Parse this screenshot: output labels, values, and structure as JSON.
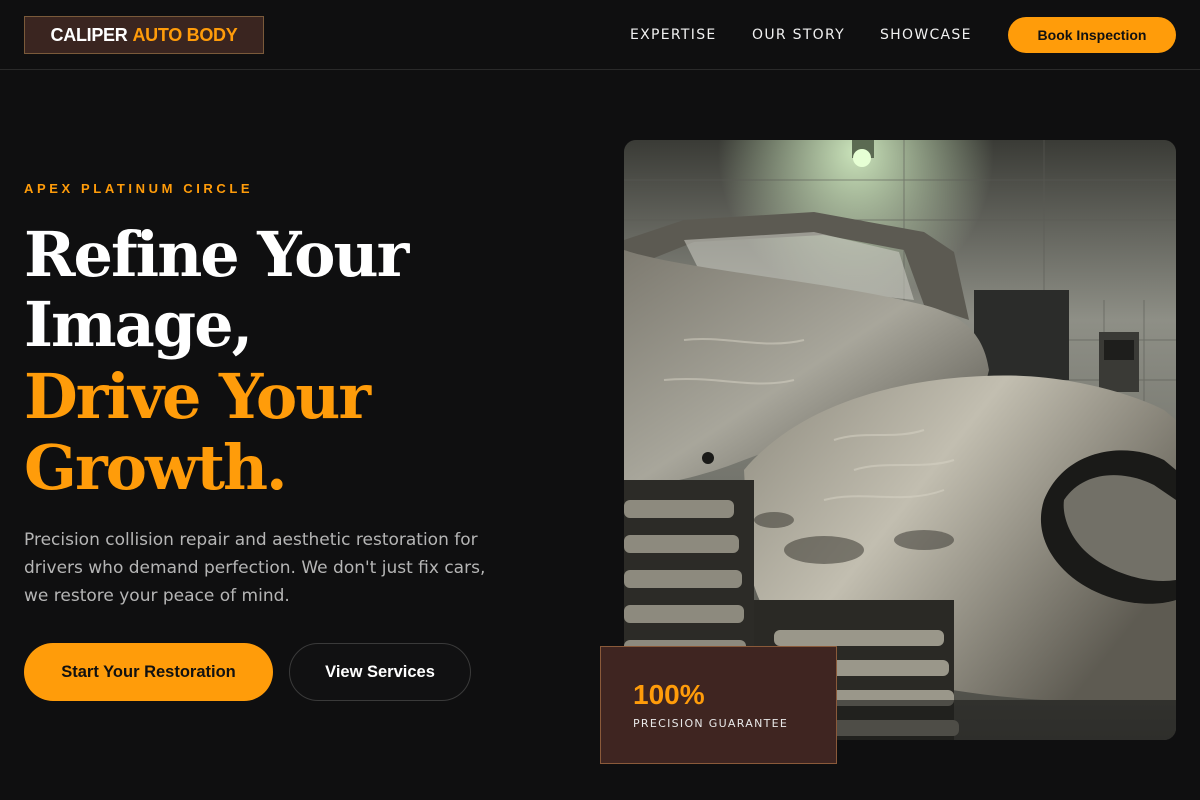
{
  "brand": {
    "name_part1": "CALIPER",
    "name_part2": "AUTO BODY",
    "accent_color": "#ff9c0a",
    "logo_bg_color": "#3a2520"
  },
  "nav": {
    "items": [
      {
        "label": "EXPERTISE"
      },
      {
        "label": "OUR STORY"
      },
      {
        "label": "SHOWCASE"
      }
    ],
    "cta_label": "Book Inspection"
  },
  "hero": {
    "eyebrow": "APEX PLATINUM CIRCLE",
    "headline_lines": [
      {
        "text": "Refine Your"
      },
      {
        "text": "Image,"
      },
      {
        "text": "Drive Your"
      },
      {
        "text": "Growth."
      }
    ],
    "description_lines": [
      "Precision collision repair and aesthetic restoration for",
      "drivers who demand perfection. We don't just fix cars,",
      "we restore your peace of mind."
    ],
    "primary_cta": "Start Your Restoration",
    "secondary_cta": "View Services",
    "image_subject": "bare-metal-classic-car-in-garage"
  },
  "stat": {
    "value": "100%",
    "label": "PRECISION GUARANTEE"
  }
}
